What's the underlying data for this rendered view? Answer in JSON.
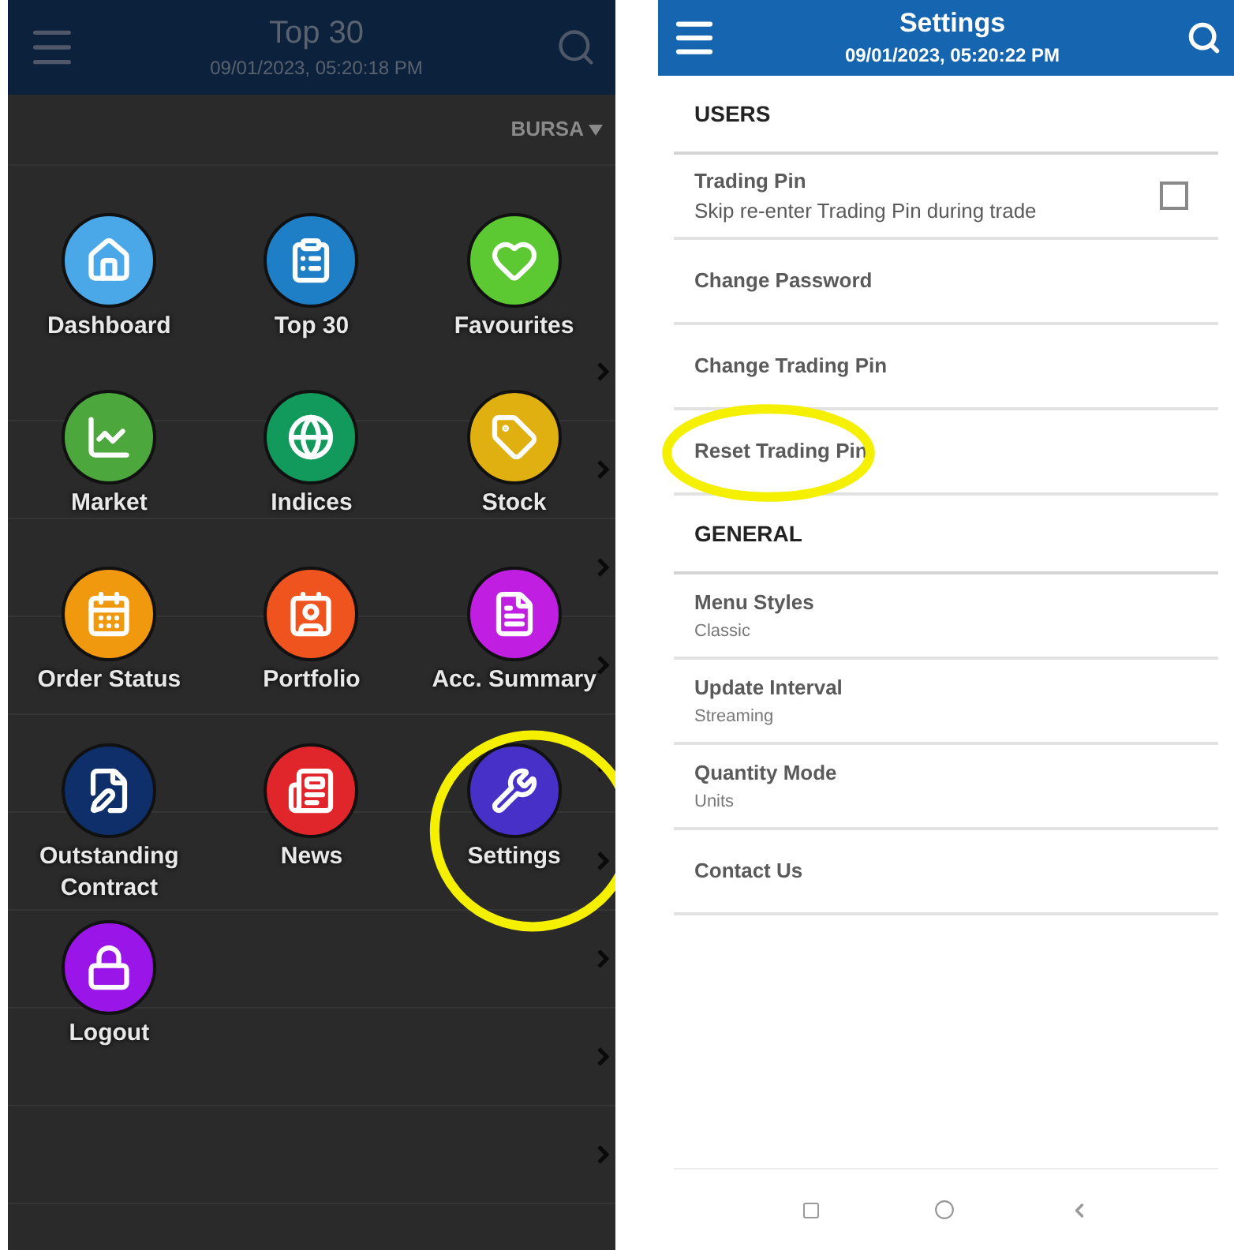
{
  "menu_screen": {
    "header": {
      "title": "Top 30",
      "subtitle": "09/01/2023, 05:20:18 PM"
    },
    "exchange": "BURSA",
    "menu": [
      {
        "label": "Dashboard",
        "kind": "home",
        "color": "#4aa8e8",
        "highlighted": false
      },
      {
        "label": "Top 30",
        "kind": "top",
        "color": "#1f7fc6",
        "highlighted": false
      },
      {
        "label": "Favourites",
        "kind": "heart",
        "color": "#5cc832",
        "highlighted": false
      },
      {
        "label": "Market",
        "kind": "chart",
        "color": "#4ca83c",
        "highlighted": false
      },
      {
        "label": "Indices",
        "kind": "globe",
        "color": "#129a5c",
        "highlighted": false
      },
      {
        "label": "Stock",
        "kind": "tag",
        "color": "#e0b010",
        "highlighted": false
      },
      {
        "label": "Order Status",
        "kind": "order",
        "color": "#f0980e",
        "highlighted": false
      },
      {
        "label": "Portfolio",
        "kind": "portfolio",
        "color": "#f0541e",
        "highlighted": false
      },
      {
        "label": "Acc. Summary",
        "kind": "summary",
        "color": "#c01ee0",
        "highlighted": false
      },
      {
        "label": "Outstanding Contract",
        "kind": "contract",
        "color": "#0e2f6a",
        "highlighted": false
      },
      {
        "label": "News",
        "kind": "news",
        "color": "#e0262a",
        "highlighted": false
      },
      {
        "label": "Settings",
        "kind": "settings",
        "color": "#4630c8",
        "highlighted": true
      },
      {
        "label": "Logout",
        "kind": "lock",
        "color": "#9a16e8",
        "highlighted": false
      }
    ]
  },
  "settings_screen": {
    "header": {
      "title": "Settings",
      "subtitle": "09/01/2023, 05:20:22 PM"
    },
    "sections": [
      {
        "heading": "USERS",
        "items": [
          {
            "label": "Trading Pin",
            "sublabel": "Skip re-enter Trading Pin during trade",
            "kind": "checkbox",
            "checked": false,
            "highlighted": false
          },
          {
            "label": "Change Password",
            "kind": "link",
            "highlighted": false
          },
          {
            "label": "Change Trading Pin",
            "kind": "link",
            "highlighted": false
          },
          {
            "label": "Reset Trading Pin",
            "kind": "link",
            "highlighted": true
          }
        ]
      },
      {
        "heading": "GENERAL",
        "items": [
          {
            "label": "Menu Styles",
            "sublabel": "Classic",
            "kind": "link",
            "highlighted": false
          },
          {
            "label": "Update Interval",
            "sublabel": "Streaming",
            "kind": "link",
            "highlighted": false
          },
          {
            "label": "Quantity Mode",
            "sublabel": "Units",
            "kind": "link",
            "highlighted": false
          },
          {
            "label": "Contact Us",
            "kind": "link",
            "highlighted": false
          }
        ]
      }
    ]
  }
}
